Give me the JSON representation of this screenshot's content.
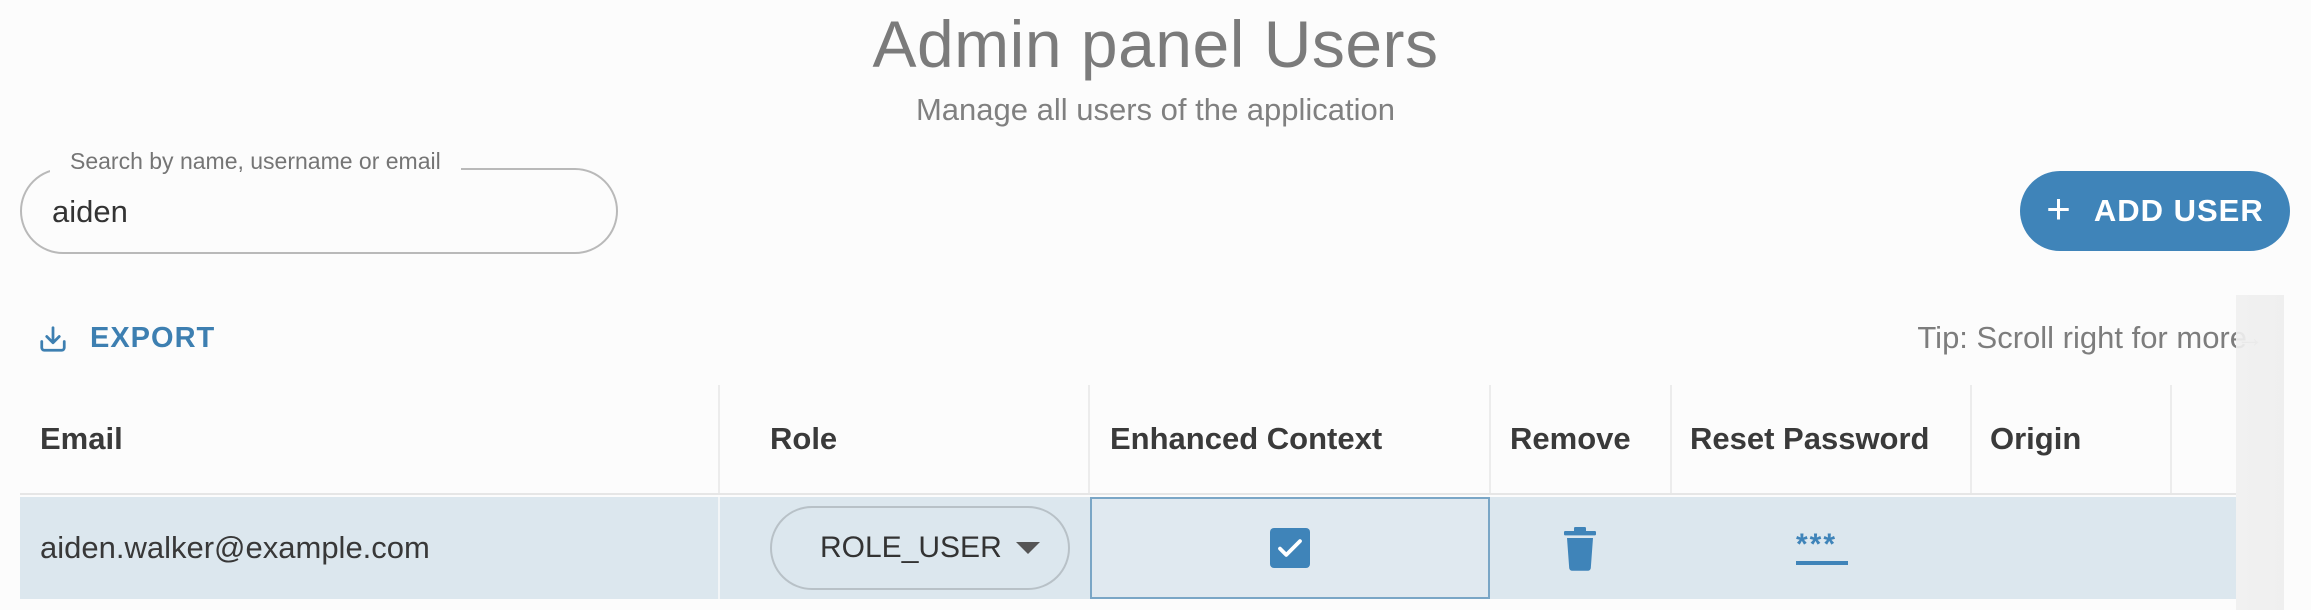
{
  "header": {
    "title": "Admin panel Users",
    "subtitle": "Manage all users of the application"
  },
  "search": {
    "label": "Search by name, username or email",
    "value": "aiden",
    "placeholder": ""
  },
  "toolbar": {
    "add_user_label": "ADD USER",
    "add_user_icon": "plus-icon",
    "export_label": "EXPORT",
    "export_icon": "download-icon",
    "tip": "Tip: Scroll right for more",
    "tip_arrow": "→"
  },
  "table": {
    "columns": [
      "Email",
      "Role",
      "Enhanced Context",
      "Remove",
      "Reset Password",
      "Origin"
    ],
    "rows": [
      {
        "email": "aiden.walker@example.com",
        "role": "ROLE_USER",
        "enhanced_context": true,
        "remove_icon": "trash-icon",
        "reset_password": "***",
        "origin": ""
      }
    ]
  },
  "colors": {
    "accent": "#3f84b9",
    "row_highlight": "#dce7ee",
    "title_gray": "#7b7b7b"
  }
}
